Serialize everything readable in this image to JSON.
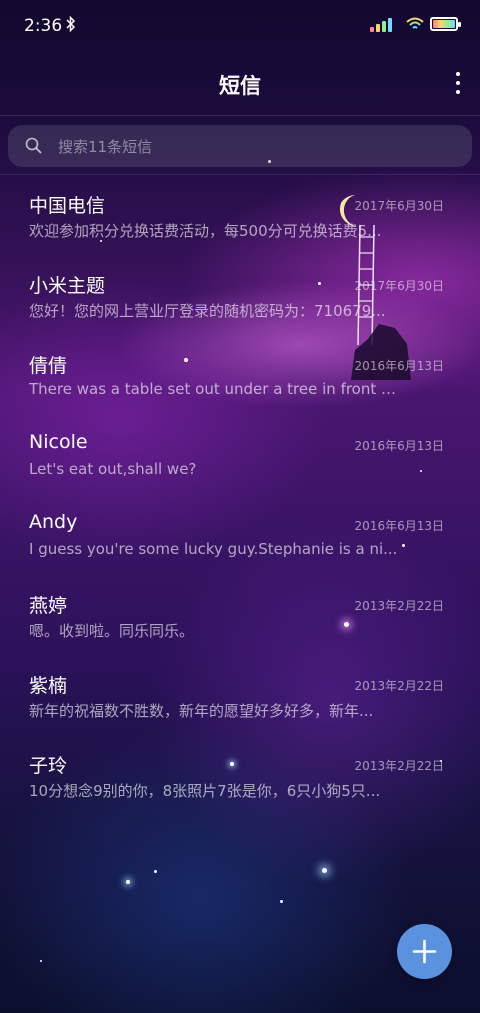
{
  "status_bar": {
    "time": "2:36",
    "icons": [
      "bluetooth-icon",
      "signal-icon",
      "wifi-icon",
      "battery-icon"
    ]
  },
  "header": {
    "title": "短信",
    "menu_icon": "more-vertical-icon"
  },
  "search": {
    "placeholder": "搜索11条短信",
    "icon": "search-icon"
  },
  "conversations": [
    {
      "name": "中国电信",
      "date": "2017年6月30日",
      "preview": "欢迎参加积分兑换话费活动，每500分可兑换话费5..."
    },
    {
      "name": "小米主题",
      "date": "2017年6月30日",
      "preview": "您好！您的网上营业厅登录的随机密码为：710679..."
    },
    {
      "name": "倩倩",
      "date": "2016年6月13日",
      "preview": "There was a table set out under a tree in front of ..."
    },
    {
      "name": "Nicole",
      "date": "2016年6月13日",
      "preview": "Let's eat out,shall we?"
    },
    {
      "name": "Andy",
      "date": "2016年6月13日",
      "preview": "I guess you're some lucky guy.Stephanie is a ni..."
    },
    {
      "name": "燕婷",
      "date": "2013年2月22日",
      "preview": "嗯。收到啦。同乐同乐。"
    },
    {
      "name": "紫楠",
      "date": "2013年2月22日",
      "preview": "新年的祝福数不胜数，新年的愿望好多好多，新年..."
    },
    {
      "name": "子玲",
      "date": "2013年2月22日",
      "preview": "10分想念9别的你，8张照片7张是你，6只小狗5只..."
    }
  ],
  "fab": {
    "icon": "plus-icon"
  },
  "colors": {
    "fab": "#5a92e0",
    "background_top": "#12082e",
    "background_mid": "#4a1670",
    "background_bottom": "#0b0f2c"
  }
}
